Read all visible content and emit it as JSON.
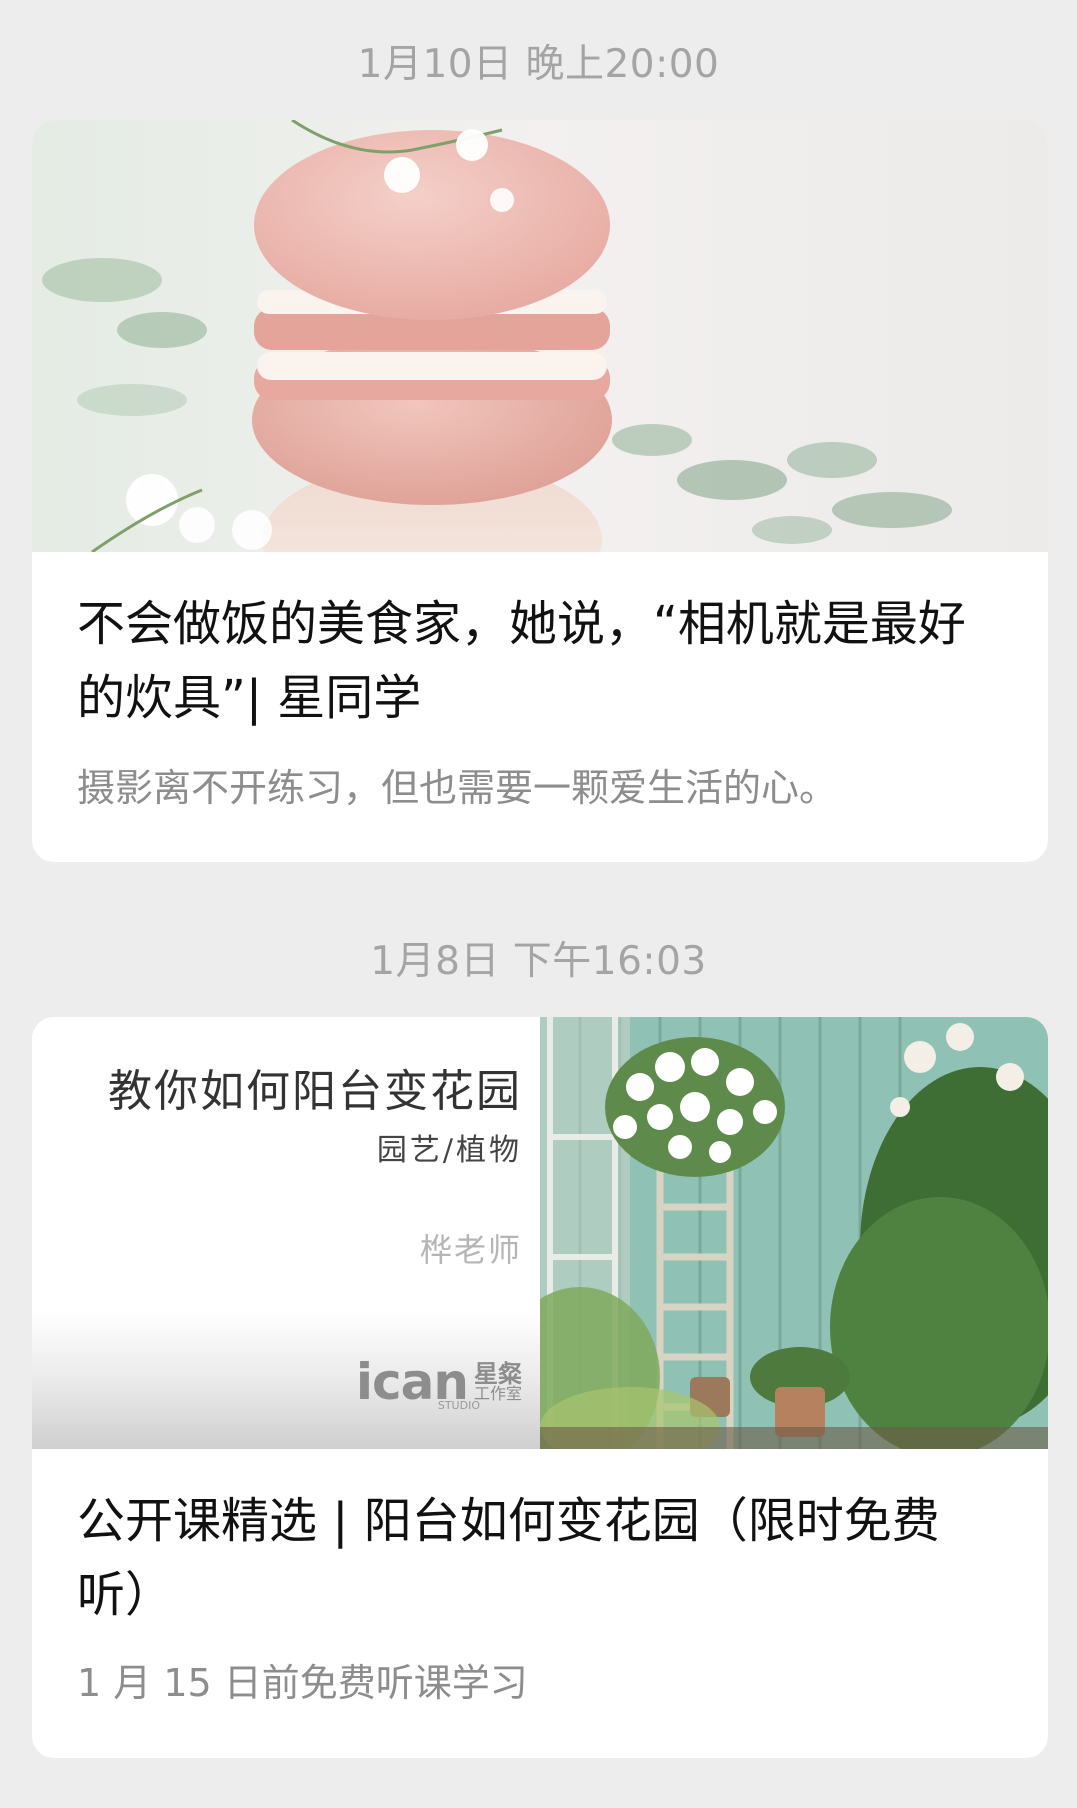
{
  "feed": [
    {
      "timestamp": "1月10日 晚上20:00",
      "title": "不会做饭的美食家，她说，“相机就是最好的炊具”| 星同学",
      "description": "摄影离不开练习，但也需要一颗爱生活的心。"
    },
    {
      "timestamp": "1月8日 下午16:03",
      "title": "公开课精选 | 阳台如何变花园（限时免费听）",
      "description": "1 月 15 日前免费听课学习",
      "cover": {
        "course_title": "教你如何阳台变花园",
        "course_category": "园艺/植物",
        "teacher": "桦老师",
        "logo_main": "ican",
        "logo_cn": "星粲",
        "logo_cn_sub": "工作室",
        "logo_studio": "STUDIO"
      }
    }
  ],
  "colors": {
    "background": "#ededed",
    "card": "#ffffff",
    "timestamp": "#a4a4a4",
    "title": "#111111",
    "description": "#8d8d8d"
  }
}
